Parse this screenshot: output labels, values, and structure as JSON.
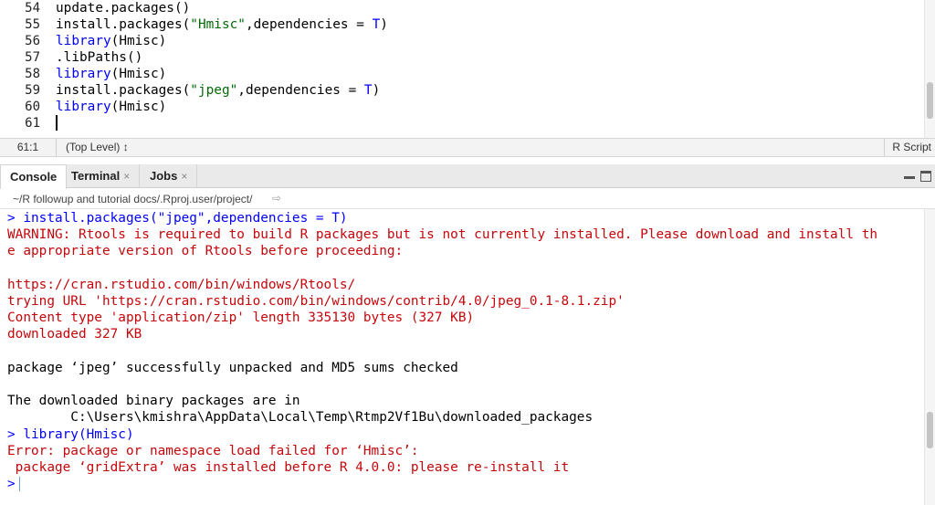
{
  "editor": {
    "lines": [
      {
        "num": "54",
        "parts": [
          {
            "t": "update.packages()",
            "c": "fn"
          }
        ]
      },
      {
        "num": "55",
        "parts": [
          {
            "t": "install.packages(",
            "c": "fn"
          },
          {
            "t": "\"Hmisc\"",
            "c": "str"
          },
          {
            "t": ",dependencies = ",
            "c": "fn"
          },
          {
            "t": "T",
            "c": "kw"
          },
          {
            "t": ")",
            "c": "fn"
          }
        ]
      },
      {
        "num": "56",
        "parts": [
          {
            "t": "library",
            "c": "lib"
          },
          {
            "t": "(Hmisc)",
            "c": "fn"
          }
        ]
      },
      {
        "num": "57",
        "parts": [
          {
            "t": ".libPaths()",
            "c": "fn"
          }
        ]
      },
      {
        "num": "58",
        "parts": [
          {
            "t": "library",
            "c": "lib"
          },
          {
            "t": "(Hmisc)",
            "c": "fn"
          }
        ]
      },
      {
        "num": "59",
        "parts": [
          {
            "t": "install.packages(",
            "c": "fn"
          },
          {
            "t": "\"jpeg\"",
            "c": "str"
          },
          {
            "t": ",dependencies = ",
            "c": "fn"
          },
          {
            "t": "T",
            "c": "kw"
          },
          {
            "t": ")",
            "c": "fn"
          }
        ]
      },
      {
        "num": "60",
        "parts": [
          {
            "t": "library",
            "c": "lib"
          },
          {
            "t": "(Hmisc)",
            "c": "fn"
          }
        ]
      },
      {
        "num": "61",
        "parts": []
      }
    ]
  },
  "statusbar": {
    "position": "61:1",
    "scope": "(Top Level) ↕",
    "file_type": "R Script"
  },
  "tabs": [
    {
      "label": "Console",
      "closable": false,
      "active": true
    },
    {
      "label": "Terminal",
      "closable": true,
      "active": false
    },
    {
      "label": "Jobs",
      "closable": true,
      "active": false
    }
  ],
  "tab_close_glyph": "×",
  "console": {
    "working_dir": "~/R followup and tutorial docs/.Rproj.user/project/",
    "lines": [
      {
        "text": "> install.packages(\"jpeg\",dependencies = T)",
        "kind": "prompt"
      },
      {
        "text": "WARNING: Rtools is required to build R packages but is not currently installed. Please download and install th",
        "kind": "err"
      },
      {
        "text": "e appropriate version of Rtools before proceeding:",
        "kind": "err"
      },
      {
        "text": "",
        "kind": "out"
      },
      {
        "text": "https://cran.rstudio.com/bin/windows/Rtools/",
        "kind": "err"
      },
      {
        "text": "trying URL 'https://cran.rstudio.com/bin/windows/contrib/4.0/jpeg_0.1-8.1.zip'",
        "kind": "err"
      },
      {
        "text": "Content type 'application/zip' length 335130 bytes (327 KB)",
        "kind": "err"
      },
      {
        "text": "downloaded 327 KB",
        "kind": "err"
      },
      {
        "text": "",
        "kind": "out"
      },
      {
        "text": "package ‘jpeg’ successfully unpacked and MD5 sums checked",
        "kind": "out"
      },
      {
        "text": "",
        "kind": "out"
      },
      {
        "text": "The downloaded binary packages are in",
        "kind": "out"
      },
      {
        "text": "        C:\\Users\\kmishra\\AppData\\Local\\Temp\\Rtmp2Vf1Bu\\downloaded_packages",
        "kind": "out"
      },
      {
        "text": "> library(Hmisc)",
        "kind": "prompt"
      },
      {
        "text": "Error: package or namespace load failed for ‘Hmisc’:",
        "kind": "err"
      },
      {
        "text": " package ‘gridExtra’ was installed before R 4.0.0: please re-install it",
        "kind": "err"
      },
      {
        "text": ">",
        "kind": "prompt",
        "cursor": true
      }
    ]
  },
  "colors": {
    "prompt": "#0000ff",
    "error": "#c5060b",
    "string": "#036a07",
    "keyword": "#0000ff"
  },
  "icons": {
    "goto_dir": "arrow-right-icon",
    "minimize": "minimize-pane-icon",
    "maximize": "maximize-pane-icon"
  }
}
